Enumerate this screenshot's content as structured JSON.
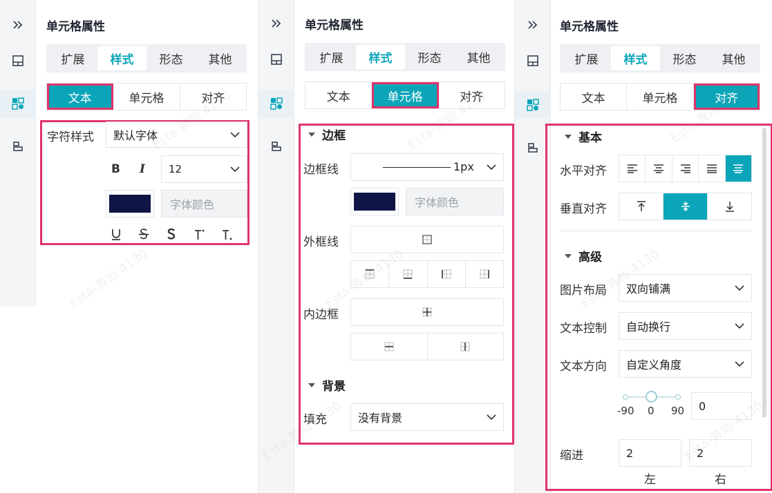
{
  "panels": [
    {
      "title": "单元格属性",
      "tabs": [
        "扩展",
        "样式",
        "形态",
        "其他"
      ],
      "segments": [
        "文本",
        "单元格",
        "对齐"
      ],
      "text": {
        "font_style_label": "字符样式",
        "font_family": "默认字体",
        "bold": "B",
        "italic": "I",
        "font_size": "12",
        "font_color_placeholder": "字体颜色",
        "color_value": "#0f1645"
      }
    },
    {
      "title": "单元格属性",
      "tabs": [
        "扩展",
        "样式",
        "形态",
        "其他"
      ],
      "segments": [
        "文本",
        "单元格",
        "对齐"
      ],
      "cell": {
        "border_section": "边框",
        "border_line_label": "边框线",
        "border_width": "1px",
        "font_color_placeholder": "字体颜色",
        "outer_border_label": "外框线",
        "inner_border_label": "内边框",
        "background_section": "背景",
        "fill_label": "填充",
        "fill_value": "没有背景"
      }
    },
    {
      "title": "单元格属性",
      "tabs": [
        "扩展",
        "样式",
        "形态",
        "其他"
      ],
      "segments": [
        "文本",
        "单元格",
        "对齐"
      ],
      "align": {
        "basic_section": "基本",
        "horizontal_label": "水平对齐",
        "vertical_label": "垂直对齐",
        "advanced_section": "高级",
        "image_layout_label": "图片布局",
        "image_layout_value": "双向铺满",
        "text_control_label": "文本控制",
        "text_control_value": "自动换行",
        "text_direction_label": "文本方向",
        "text_direction_value": "自定义角度",
        "slider_min": "-90",
        "slider_mid": "0",
        "slider_max": "90",
        "angle_value": "0",
        "indent_label": "缩进",
        "indent_left": "2",
        "indent_right": "2",
        "left_label": "左",
        "right_label": "右"
      }
    }
  ],
  "watermark": "Esta-黄灿 4130",
  "colors": {
    "accent": "#0aa5b8",
    "highlight": "#e0336b",
    "swatch": "#0f1645"
  }
}
